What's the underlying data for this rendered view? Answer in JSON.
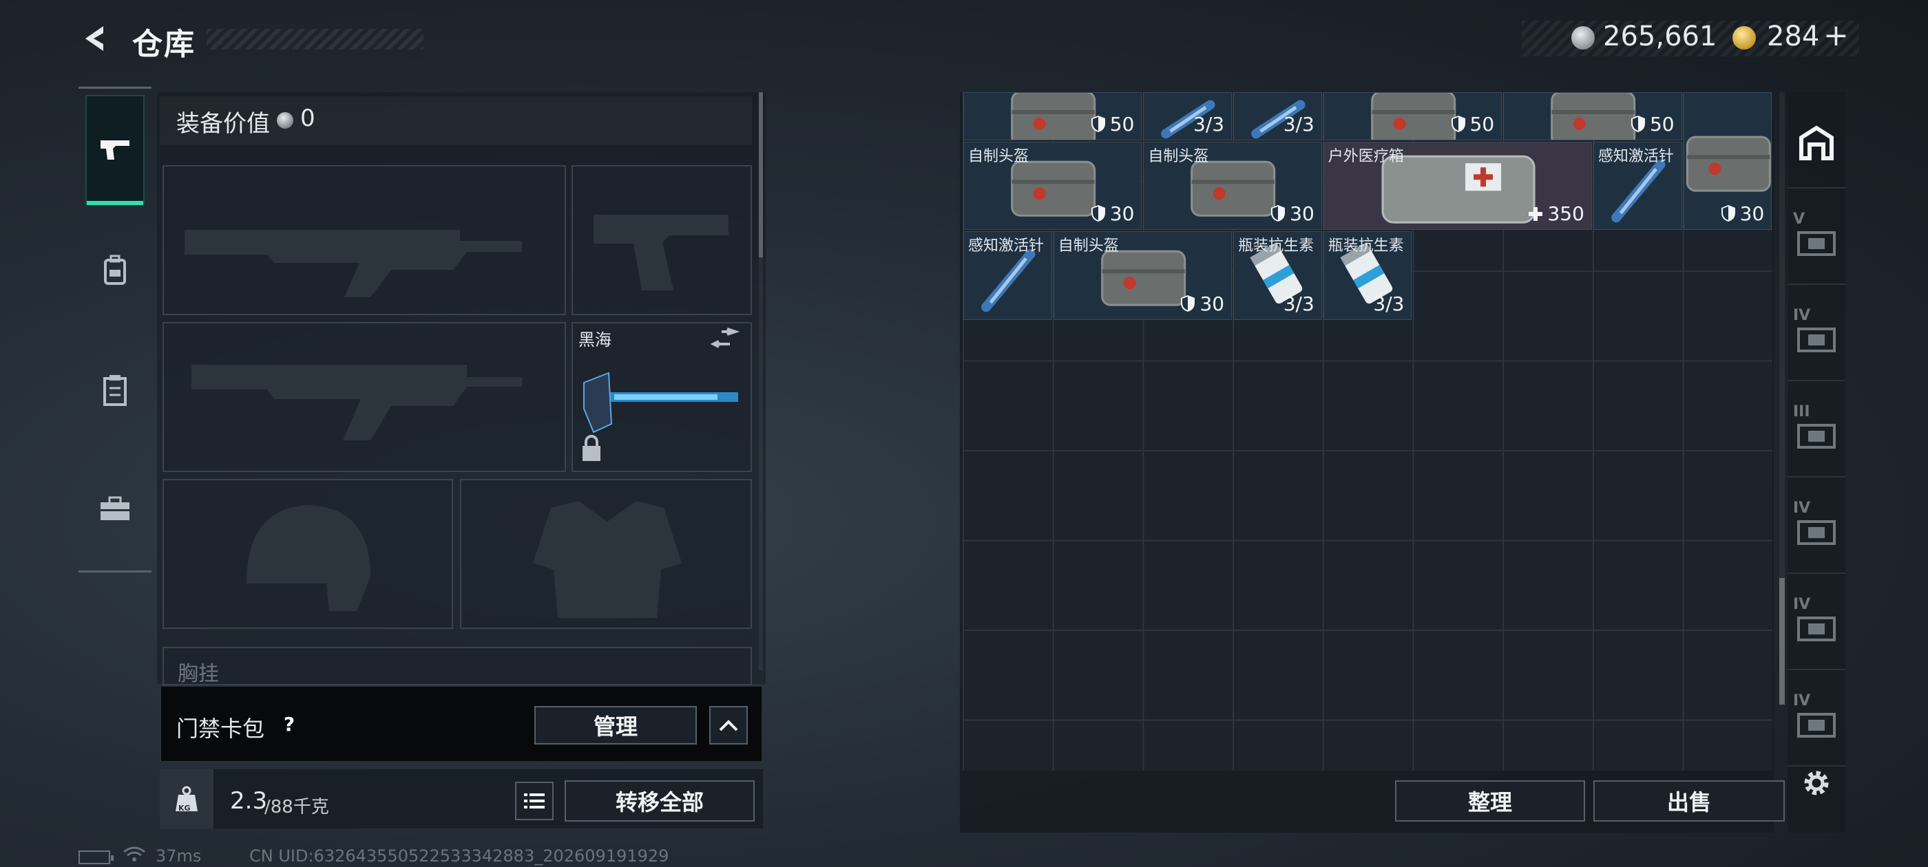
{
  "header": {
    "title": "仓库",
    "silver_amount": "265,661",
    "gold_amount": "284",
    "gold_plus": "+"
  },
  "tabs": [
    {
      "icon": "pistol-icon",
      "active": true
    },
    {
      "icon": "backpack-icon",
      "active": false
    },
    {
      "icon": "clipboard-icon",
      "active": false
    },
    {
      "icon": "toolbox-icon",
      "active": false
    }
  ],
  "equipment": {
    "value_label": "装备价值",
    "value_amount": "0",
    "melee_name": "黑海",
    "chest_label": "胸挂"
  },
  "keycard": {
    "label": "门禁卡包",
    "help": "?",
    "manage_label": "管理"
  },
  "weight": {
    "current": "2.3",
    "max": "/88千克",
    "icon_text": "KG"
  },
  "transfer_all_label": "转移全部",
  "warehouse": {
    "items": [
      {
        "name": "",
        "value": "50",
        "icon": "shield-icon"
      },
      {
        "name": "",
        "value": "3/3",
        "icon": ""
      },
      {
        "name": "",
        "value": "3/3",
        "icon": ""
      },
      {
        "name": "",
        "value": "50",
        "icon": "shield-icon"
      },
      {
        "name": "",
        "value": "50",
        "icon": "shield-icon"
      },
      {
        "name": "自制头盔",
        "value": "30",
        "icon": "shield-icon"
      },
      {
        "name": "自制头盔",
        "value": "30",
        "icon": "shield-icon"
      },
      {
        "name": "户外医疗箱",
        "value": "350",
        "icon": "plus-icon"
      },
      {
        "name": "感知激活针",
        "value": "",
        "icon": ""
      },
      {
        "name": "",
        "value": "30",
        "icon": "shield-icon"
      },
      {
        "name": "感知激活针",
        "value": "",
        "icon": ""
      },
      {
        "name": "自制头盔",
        "value": "30",
        "icon": "shield-icon"
      },
      {
        "name": "瓶装抗生素",
        "value": "3/3",
        "icon": ""
      },
      {
        "name": "瓶装抗生素",
        "value": "3/3",
        "icon": ""
      }
    ],
    "sort_label": "整理",
    "sell_label": "出售"
  },
  "right_rail": [
    {
      "icon": "safehouse-icon"
    },
    {
      "icon": "storage-v-icon",
      "tier": "V"
    },
    {
      "icon": "storage-iv-icon",
      "tier": "IV"
    },
    {
      "icon": "storage-iii-icon",
      "tier": "III"
    },
    {
      "icon": "storage-iv-b-icon",
      "tier": "IV"
    },
    {
      "icon": "storage-iv-c-icon",
      "tier": "IV"
    },
    {
      "icon": "storage-iv-add-icon",
      "tier": "IV"
    }
  ],
  "status": {
    "ping": "37ms",
    "uid": "CN UID:632643550522533342883_202609191929"
  },
  "colors": {
    "accent": "#2ee0b0",
    "item_bg": "#1f3140",
    "med_bg": "#3a3646"
  }
}
